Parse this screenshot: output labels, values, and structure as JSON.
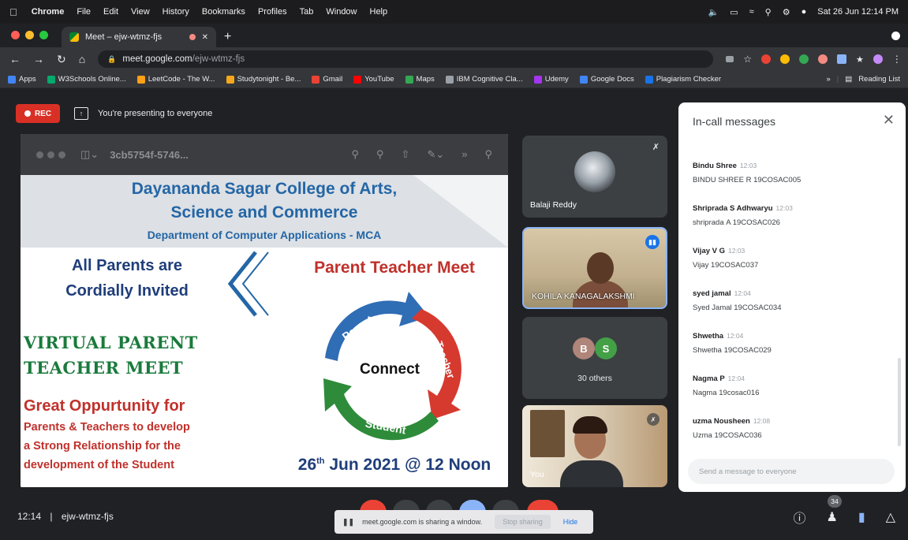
{
  "menubar": {
    "app": "Chrome",
    "items": [
      "File",
      "Edit",
      "View",
      "History",
      "Bookmarks",
      "Profiles",
      "Tab",
      "Window",
      "Help"
    ],
    "clock": "Sat 26 Jun 12:14 PM"
  },
  "browser": {
    "tab_title": "Meet – ejw-wtmz-fjs",
    "url_host": "meet.google.com",
    "url_path": "/ejw-wtmz-fjs",
    "bookmarks": [
      {
        "label": "Apps",
        "color": "#4285f4"
      },
      {
        "label": "W3Schools Online...",
        "color": "#04aa6d"
      },
      {
        "label": "LeetCode - The W...",
        "color": "#ffa116"
      },
      {
        "label": "Studytonight - Be...",
        "color": "#f6a81b"
      },
      {
        "label": "Gmail",
        "color": "#ea4335"
      },
      {
        "label": "YouTube",
        "color": "#ff0000"
      },
      {
        "label": "Maps",
        "color": "#34a853"
      },
      {
        "label": "IBM Cognitive Cla...",
        "color": "#9aa0a6"
      },
      {
        "label": "Udemy",
        "color": "#a435f0"
      },
      {
        "label": "Google Docs",
        "color": "#4285f4"
      },
      {
        "label": "Plagiarism Checker",
        "color": "#1a73e8"
      }
    ],
    "bookmarks_overflow": "»",
    "reading_list": "Reading List"
  },
  "meet": {
    "rec_label": "REC",
    "presenting_text": "You're presenting to everyone",
    "viewer_filename": "3cb5754f-5746...",
    "slide": {
      "header_line1": "Dayananda Sagar College of Arts,",
      "header_line2": "Science and Commerce",
      "header_line3": "Department of Computer Applications - MCA",
      "invite_line1": "All Parents are",
      "invite_line2": "Cordially Invited",
      "virtual_line1": "VIRTUAL PARENT",
      "virtual_line2": "TEACHER MEET",
      "opp_line1": "Great Oppurtunity for",
      "opp_line2": "Parents & Teachers to develop",
      "opp_line3": "a Strong Relationship for the",
      "opp_line4": "development of the Student",
      "meet_title": "Parent Teacher Meet",
      "cycle_center": "Connect",
      "cycle_parent": "Parent",
      "cycle_teacher": "Teacher",
      "cycle_student": "Student",
      "date_day": "26",
      "date_suffix": "th",
      "date_rest": " Jun 2021 @ 12 Noon"
    },
    "participants": [
      {
        "name": "Balaji Reddy"
      },
      {
        "name": "KOHILA KANAGALAKSHMI"
      },
      {
        "initials": [
          "B",
          "S"
        ],
        "others": "30 others"
      },
      {
        "name": "You"
      }
    ]
  },
  "chat": {
    "title": "In-call messages",
    "messages": [
      {
        "sender": "Bindu Shree",
        "time": "12:03",
        "text": "BINDU SHREE R 19COSAC005"
      },
      {
        "sender": "Shripradа S Adhwaryu",
        "time": "12:03",
        "text": "shripradа A 19COSAC026"
      },
      {
        "sender": "Vijay V G",
        "time": "12:03",
        "text": "Vijay 19COSAC037"
      },
      {
        "sender": "syed jamal",
        "time": "12:04",
        "text": "Syed Jamal 19COSAC034"
      },
      {
        "sender": "Shwetha",
        "time": "12:04",
        "text": "Shwetha 19COSAC029"
      },
      {
        "sender": "Nagma P",
        "time": "12:04",
        "text": "Nagma 19cosac016"
      },
      {
        "sender": "uzma Nousheen",
        "time": "12:08",
        "text": "Uzma 19COSAC036"
      }
    ],
    "input_placeholder": "Send a message to everyone"
  },
  "bottom": {
    "time": "12:14",
    "separator": "|",
    "meeting_code": "ejw-wtmz-fjs",
    "share_notice": "meet.google.com is sharing a window.",
    "stop_sharing": "Stop sharing",
    "hide": "Hide",
    "participant_count": "34"
  }
}
